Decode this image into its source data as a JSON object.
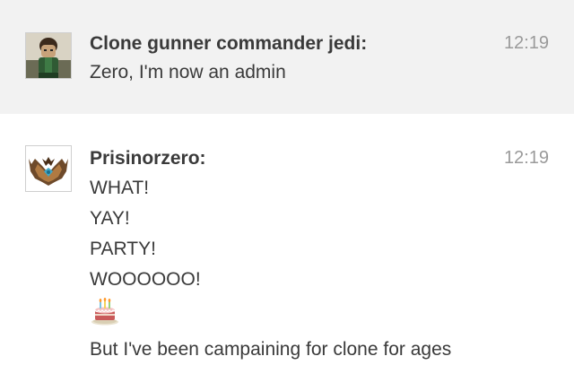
{
  "messages": [
    {
      "username": "Clone gunner commander jedi:",
      "time": "12:19",
      "avatar_icon": "lego-minifigure-avatar",
      "lines": [
        "Zero, I'm now an admin"
      ]
    },
    {
      "username": "Prisinorzero:",
      "time": "12:19",
      "avatar_icon": "bat-emblem-avatar",
      "lines": [
        "WHAT!",
        "YAY!",
        "PARTY!",
        "WOOOOOO!"
      ],
      "emoji_icon": "cake-emoji",
      "last_line": "But I've been campaining for clone for ages"
    }
  ]
}
